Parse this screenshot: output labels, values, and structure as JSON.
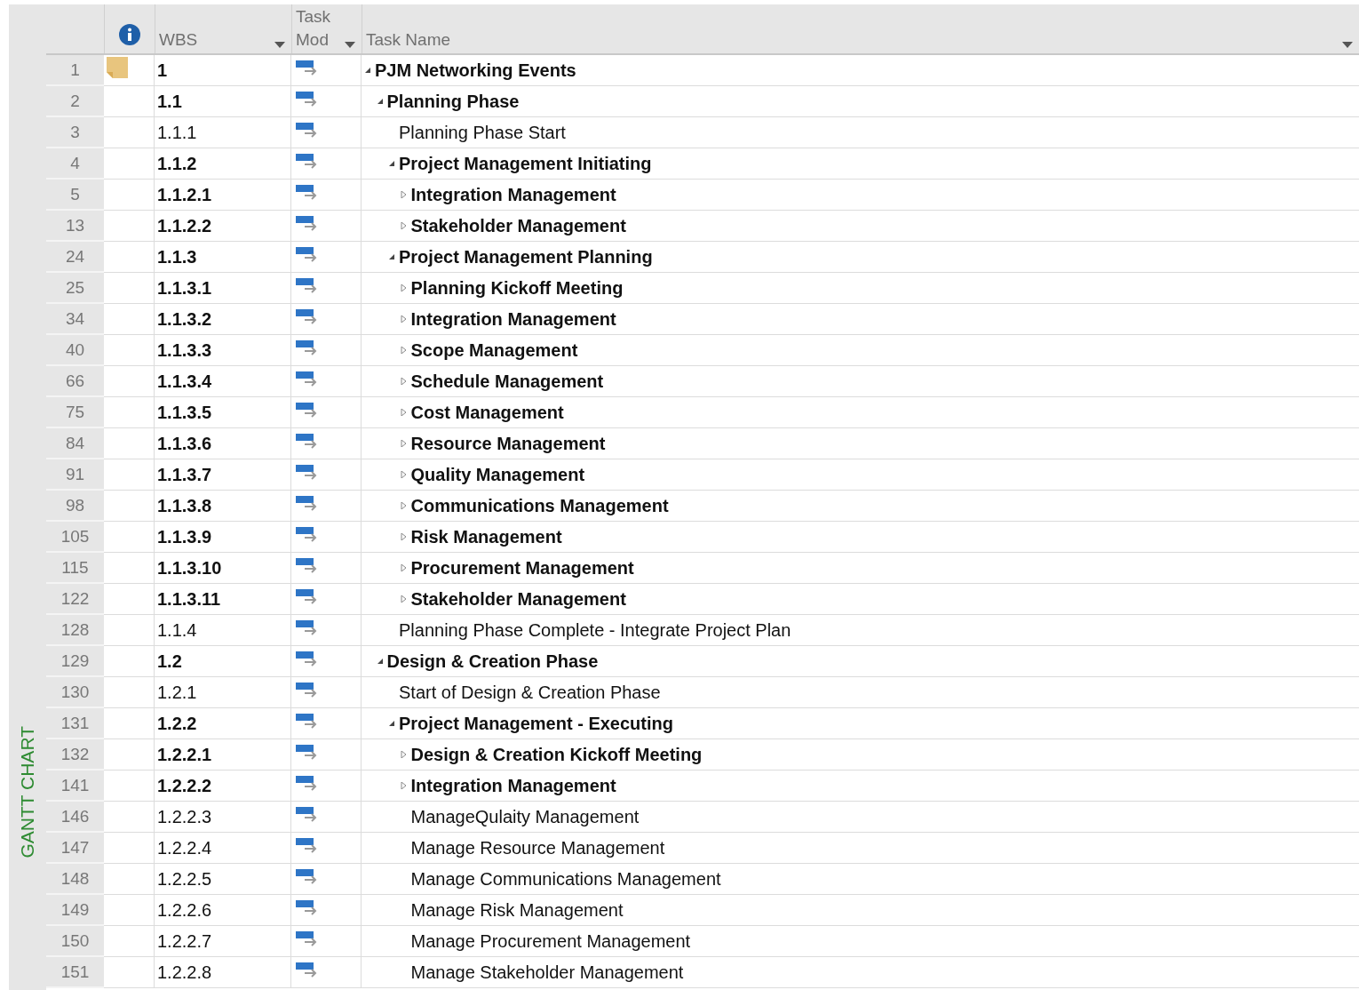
{
  "view_bar": {
    "label": "GANTT CHART"
  },
  "columns": [
    {
      "kind": "info",
      "filter": false
    },
    {
      "kind": "text",
      "lines": [
        "WBS"
      ],
      "filter": true
    },
    {
      "kind": "text",
      "lines": [
        "Task",
        "Mod"
      ],
      "filter": true
    },
    {
      "kind": "text",
      "lines": [
        "Task Name"
      ],
      "filter": true
    }
  ],
  "tasks": [
    {
      "id": "1",
      "wbs": "1",
      "name": "PJM Networking Events",
      "note": true,
      "expanded": true,
      "children": [
        {
          "id": "2",
          "wbs": "1.1",
          "name": "Planning Phase",
          "note": false,
          "expanded": true,
          "children": [
            {
              "id": "3",
              "wbs": "1.1.1",
              "name": "Planning Phase Start",
              "note": false
            },
            {
              "id": "4",
              "wbs": "1.1.2",
              "name": "Project Management Initiating",
              "note": false,
              "expanded": true,
              "children": [
                {
                  "id": "5",
                  "wbs": "1.1.2.1",
                  "name": "Integration Management",
                  "note": false,
                  "expanded": false
                },
                {
                  "id": "13",
                  "wbs": "1.1.2.2",
                  "name": "Stakeholder Management",
                  "note": false,
                  "expanded": false
                }
              ]
            },
            {
              "id": "24",
              "wbs": "1.1.3",
              "name": "Project Management Planning",
              "note": false,
              "expanded": true,
              "children": [
                {
                  "id": "25",
                  "wbs": "1.1.3.1",
                  "name": "Planning Kickoff Meeting",
                  "note": false,
                  "expanded": false
                },
                {
                  "id": "34",
                  "wbs": "1.1.3.2",
                  "name": "Integration Management",
                  "note": false,
                  "expanded": false
                },
                {
                  "id": "40",
                  "wbs": "1.1.3.3",
                  "name": "Scope Management",
                  "note": false,
                  "expanded": false
                },
                {
                  "id": "66",
                  "wbs": "1.1.3.4",
                  "name": "Schedule Management",
                  "note": false,
                  "expanded": false
                },
                {
                  "id": "75",
                  "wbs": "1.1.3.5",
                  "name": "Cost Management",
                  "note": false,
                  "expanded": false
                },
                {
                  "id": "84",
                  "wbs": "1.1.3.6",
                  "name": "Resource Management",
                  "note": false,
                  "expanded": false
                },
                {
                  "id": "91",
                  "wbs": "1.1.3.7",
                  "name": "Quality Management",
                  "note": false,
                  "expanded": false
                },
                {
                  "id": "98",
                  "wbs": "1.1.3.8",
                  "name": "Communications Management",
                  "note": false,
                  "expanded": false
                },
                {
                  "id": "105",
                  "wbs": "1.1.3.9",
                  "name": "Risk Management",
                  "note": false,
                  "expanded": false
                },
                {
                  "id": "115",
                  "wbs": "1.1.3.10",
                  "name": "Procurement Management",
                  "note": false,
                  "expanded": false
                },
                {
                  "id": "122",
                  "wbs": "1.1.3.11",
                  "name": "Stakeholder Management",
                  "note": false,
                  "expanded": false
                }
              ]
            },
            {
              "id": "128",
              "wbs": "1.1.4",
              "name": "Planning Phase Complete - Integrate Project Plan",
              "note": false
            }
          ]
        },
        {
          "id": "129",
          "wbs": "1.2",
          "name": "Design & Creation Phase",
          "note": false,
          "expanded": true,
          "children": [
            {
              "id": "130",
              "wbs": "1.2.1",
              "name": "Start of Design & Creation Phase",
              "note": false
            },
            {
              "id": "131",
              "wbs": "1.2.2",
              "name": "Project Management - Executing",
              "note": false,
              "expanded": true,
              "children": [
                {
                  "id": "132",
                  "wbs": "1.2.2.1",
                  "name": "Design & Creation Kickoff Meeting",
                  "note": false,
                  "expanded": false
                },
                {
                  "id": "141",
                  "wbs": "1.2.2.2",
                  "name": "Integration Management",
                  "note": false,
                  "expanded": false
                },
                {
                  "id": "146",
                  "wbs": "1.2.2.3",
                  "name": "ManageQulaity Management",
                  "note": false
                },
                {
                  "id": "147",
                  "wbs": "1.2.2.4",
                  "name": "Manage Resource Management",
                  "note": false
                },
                {
                  "id": "148",
                  "wbs": "1.2.2.5",
                  "name": "Manage Communications Management",
                  "note": false
                },
                {
                  "id": "149",
                  "wbs": "1.2.2.6",
                  "name": "Manage Risk Management",
                  "note": false
                },
                {
                  "id": "150",
                  "wbs": "1.2.2.7",
                  "name": "Manage Procurement Management",
                  "note": false
                },
                {
                  "id": "151",
                  "wbs": "1.2.2.8",
                  "name": "Manage Stakeholder Management",
                  "note": false
                }
              ]
            }
          ]
        }
      ]
    }
  ]
}
